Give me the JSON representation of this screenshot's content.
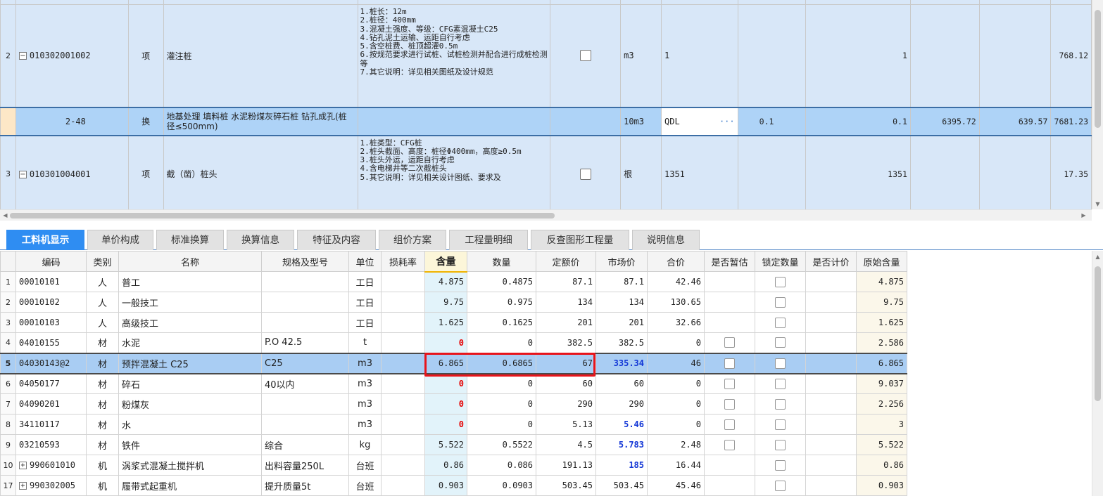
{
  "top_grid": {
    "rows": [
      {
        "row_no": "2",
        "code": "010302001002",
        "type": "项",
        "name": "灌注桩",
        "features": [
          "1.桩长：12m",
          "2.桩径：400mm",
          "3.混凝土强度、等级：CFG素混凝土C25",
          "4.钻孔泥土运输、运距自行考虑",
          "5.含空桩费、桩顶超灌0.5m",
          "6.按规范要求进行试桩、试桩检测并配合进行成桩检测等",
          "7.其它说明：详见相关图纸及设计规范"
        ],
        "unit": "m3",
        "quantity_expr": "1",
        "quantity": "1",
        "total": "768.12"
      },
      {
        "row_no": "",
        "code": "2-48",
        "type": "换",
        "name": "地基处理 填料桩 水泥粉煤灰碎石桩 钻孔成孔(桩径≤500mm)",
        "unit": "10m3",
        "quantity_expr": "QDL",
        "ellipsis": "···",
        "content": "0.1",
        "quantity": "0.1",
        "unit_price": "6395.72",
        "price": "639.57",
        "total": "7681.23"
      },
      {
        "row_no": "3",
        "code": "010301004001",
        "type": "项",
        "name": "截（凿）桩头",
        "features": [
          "1.桩类型：CFG桩",
          "2.桩头截面、高度：桩径Φ400mm，高度≥0.5m",
          "3.桩头外运，运距自行考虑",
          "4.含电梯井等二次截桩头",
          "5.其它说明：详见相关设计图纸、要求及"
        ],
        "unit": "根",
        "quantity_expr": "1351",
        "quantity": "1351",
        "total": "17.35"
      }
    ]
  },
  "tabs": [
    {
      "label": "工料机显示",
      "active": true
    },
    {
      "label": "单价构成"
    },
    {
      "label": "标准换算"
    },
    {
      "label": "换算信息"
    },
    {
      "label": "特征及内容"
    },
    {
      "label": "组价方案"
    },
    {
      "label": "工程量明细"
    },
    {
      "label": "反查图形工程量"
    },
    {
      "label": "说明信息"
    }
  ],
  "resource_grid": {
    "headers": [
      "编码",
      "类别",
      "名称",
      "规格及型号",
      "单位",
      "损耗率",
      "含量",
      "数量",
      "定额价",
      "市场价",
      "合价",
      "是否暂估",
      "锁定数量",
      "是否计价",
      "原始含量"
    ],
    "rows": [
      {
        "no": "1",
        "code": "00010101",
        "cat": "人",
        "name": "普工",
        "spec": "",
        "unit": "工日",
        "loss": "",
        "content": "4.875",
        "qty": "0.4875",
        "quota": "87.1",
        "market": "87.1",
        "amount": "42.46",
        "has_est": false,
        "orig": "4.875"
      },
      {
        "no": "2",
        "code": "00010102",
        "cat": "人",
        "name": "一般技工",
        "spec": "",
        "unit": "工日",
        "loss": "",
        "content": "9.75",
        "qty": "0.975",
        "quota": "134",
        "market": "134",
        "amount": "130.65",
        "has_est": false,
        "orig": "9.75"
      },
      {
        "no": "3",
        "code": "00010103",
        "cat": "人",
        "name": "高级技工",
        "spec": "",
        "unit": "工日",
        "loss": "",
        "content": "1.625",
        "qty": "0.1625",
        "quota": "201",
        "market": "201",
        "amount": "32.66",
        "has_est": false,
        "orig": "1.625"
      },
      {
        "no": "4",
        "code": "04010155",
        "cat": "材",
        "name": "水泥",
        "spec": "P.O 42.5",
        "unit": "t",
        "loss": "",
        "content": "0",
        "content_red": true,
        "qty": "0",
        "quota": "382.5",
        "market": "382.5",
        "amount": "0",
        "has_est": true,
        "orig": "2.586"
      },
      {
        "no": "5",
        "code": "04030143@2",
        "cat": "材",
        "name": "预拌混凝土 C25",
        "spec": "C25",
        "unit": "m3",
        "loss": "",
        "content": "6.865",
        "qty": "0.6865",
        "quota": "67",
        "market": "335.34",
        "market_blue": true,
        "amount": "46",
        "has_est": true,
        "orig": "6.865",
        "selected": true
      },
      {
        "no": "6",
        "code": "04050177",
        "cat": "材",
        "name": "碎石",
        "spec": "40以内",
        "unit": "m3",
        "loss": "",
        "content": "0",
        "content_red": true,
        "qty": "0",
        "quota": "60",
        "market": "60",
        "amount": "0",
        "has_est": true,
        "orig": "9.037"
      },
      {
        "no": "7",
        "code": "04090201",
        "cat": "材",
        "name": "粉煤灰",
        "spec": "",
        "unit": "m3",
        "loss": "",
        "content": "0",
        "content_red": true,
        "qty": "0",
        "quota": "290",
        "market": "290",
        "amount": "0",
        "has_est": true,
        "orig": "2.256"
      },
      {
        "no": "8",
        "code": "34110117",
        "cat": "材",
        "name": "水",
        "spec": "",
        "unit": "m3",
        "loss": "",
        "content": "0",
        "content_red": true,
        "qty": "0",
        "quota": "5.13",
        "market": "5.46",
        "market_blue": true,
        "amount": "0",
        "has_est": true,
        "orig": "3"
      },
      {
        "no": "9",
        "code": "03210593",
        "cat": "材",
        "name": "铁件",
        "spec": "综合",
        "unit": "kg",
        "loss": "",
        "content": "5.522",
        "qty": "0.5522",
        "quota": "4.5",
        "market": "5.783",
        "market_blue": true,
        "amount": "2.48",
        "has_est": true,
        "orig": "5.522"
      },
      {
        "no": "10",
        "code": "990601010",
        "cat": "机",
        "name": "涡浆式混凝土搅拌机",
        "spec": "出料容量250L",
        "unit": "台班",
        "loss": "",
        "content": "0.86",
        "qty": "0.086",
        "quota": "191.13",
        "market": "185",
        "market_blue": true,
        "amount": "16.44",
        "has_est": false,
        "expand": true,
        "orig": "0.86"
      },
      {
        "no": "17",
        "code": "990302005",
        "cat": "机",
        "name": "履带式起重机",
        "spec": "提升质量5t",
        "unit": "台班",
        "loss": "",
        "content": "0.903",
        "qty": "0.0903",
        "quota": "503.45",
        "market": "503.45",
        "amount": "45.46",
        "has_est": false,
        "expand": true,
        "orig": "0.903"
      }
    ]
  },
  "colors": {
    "accent": "#2f8df2",
    "selected_row": "#a9cdf3",
    "top_row_bg": "#d8e7f8",
    "highlight_red": "#e8141b",
    "value_red": "#e60000",
    "value_blue": "#1236d6"
  }
}
